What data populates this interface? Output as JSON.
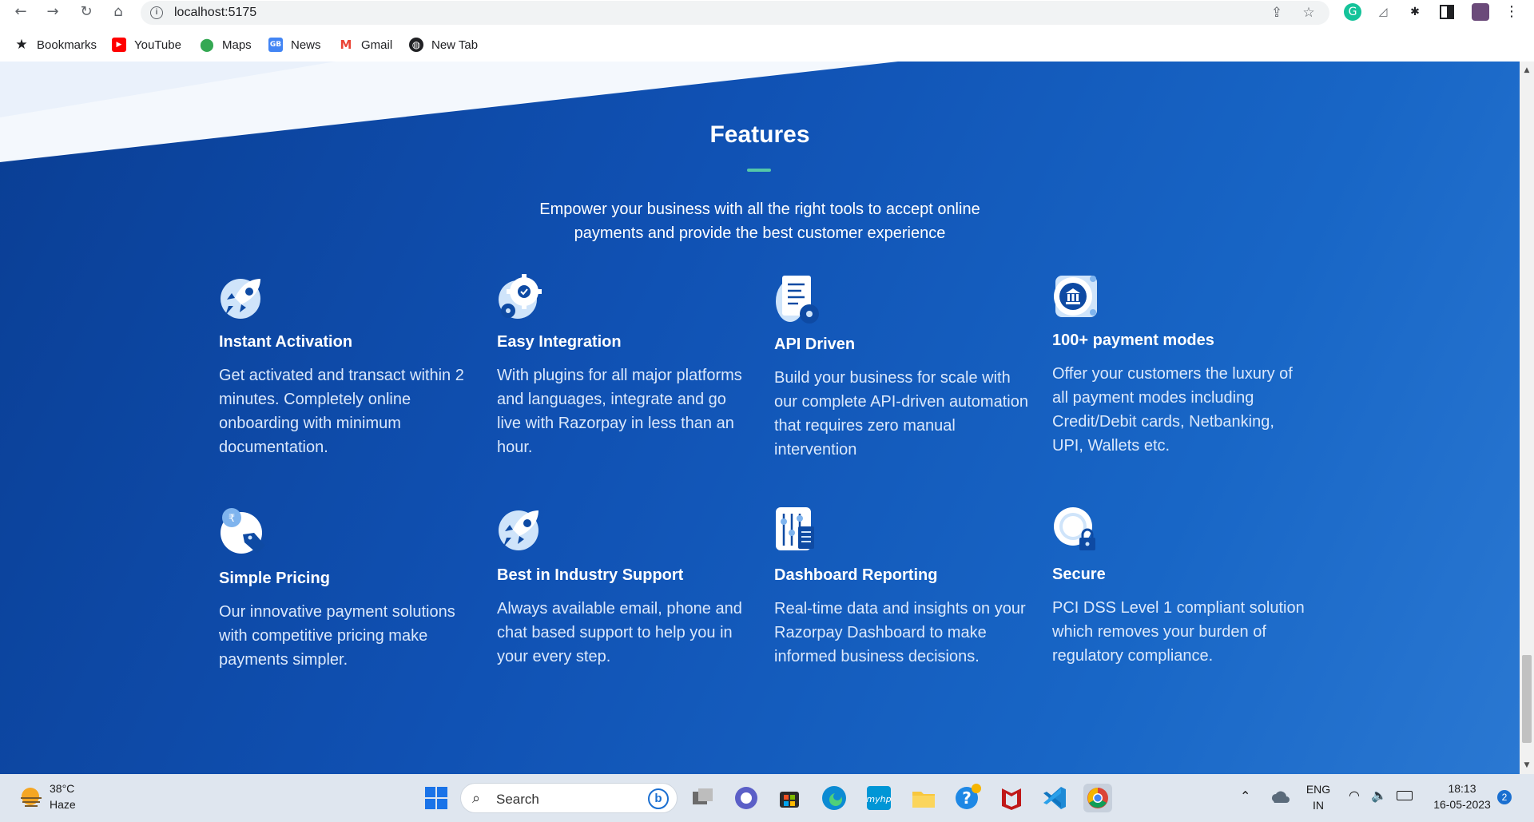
{
  "browser": {
    "url": "localhost:5175",
    "bookmarks": [
      {
        "label": "Bookmarks",
        "icon": "star-icon"
      },
      {
        "label": "YouTube",
        "icon": "youtube-icon"
      },
      {
        "label": "Maps",
        "icon": "maps-icon"
      },
      {
        "label": "News",
        "icon": "news-icon"
      },
      {
        "label": "Gmail",
        "icon": "gmail-icon"
      },
      {
        "label": "New Tab",
        "icon": "globe-icon"
      }
    ]
  },
  "features_section": {
    "title": "Features",
    "subtitle": "Empower your business with all the right tools to accept online payments and provide the best customer experience",
    "accent_color": "#55c8a8",
    "items": [
      {
        "title": "Instant Activation",
        "description": "Get activated and transact within 2 minutes. Completely online onboarding with minimum documentation.",
        "icon": "rocket-icon"
      },
      {
        "title": "Easy Integration",
        "description": "With plugins for all major platforms and languages, integrate and go live with Razorpay in less than an hour.",
        "icon": "gear-check-icon"
      },
      {
        "title": "API Driven",
        "description": "Build your business for scale with our complete API-driven automation that requires zero manual intervention",
        "icon": "document-gear-icon"
      },
      {
        "title": "100+ payment modes",
        "description": "Offer your customers the luxury of all payment modes including Credit/Debit cards, Netbanking, UPI, Wallets etc.",
        "icon": "bank-icon"
      },
      {
        "title": "Simple Pricing",
        "description": "Our innovative payment solutions with competitive pricing make payments simpler.",
        "icon": "price-tag-icon"
      },
      {
        "title": "Best in Industry Support",
        "description": "Always available email, phone and chat based support to help you in your every step.",
        "icon": "rocket-icon"
      },
      {
        "title": "Dashboard Reporting",
        "description": "Real-time data and insights on your Razorpay Dashboard to make informed business decisions.",
        "icon": "dashboard-report-icon"
      },
      {
        "title": "Secure",
        "description": "PCI DSS Level 1 compliant solution which removes your burden of regulatory compliance.",
        "icon": "lock-icon"
      }
    ]
  },
  "taskbar": {
    "weather_temp": "38°C",
    "weather_desc": "Haze",
    "search_placeholder": "Search",
    "language_line1": "ENG",
    "language_line2": "IN",
    "time": "18:13",
    "date": "16-05-2023",
    "notification_count": "2"
  }
}
